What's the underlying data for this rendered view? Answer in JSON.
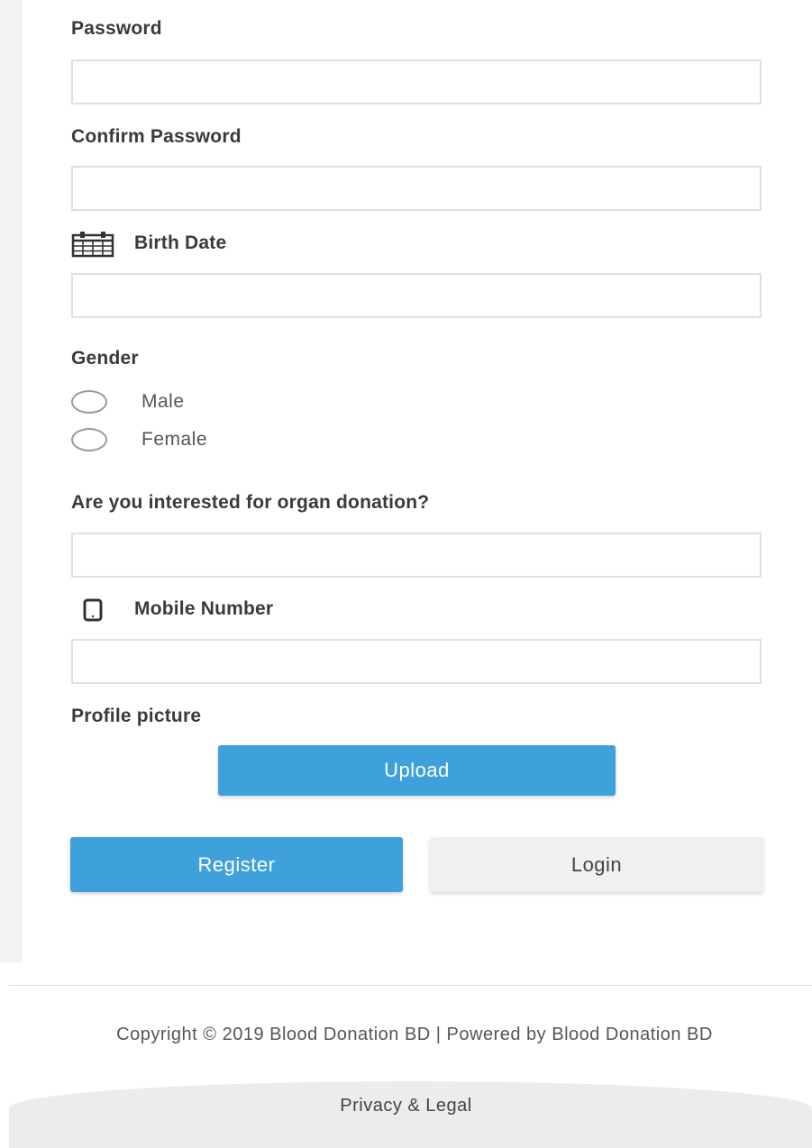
{
  "form": {
    "password_label": "Password",
    "confirm_password_label": "Confirm Password",
    "birth_date_label": "Birth Date",
    "gender_label": "Gender",
    "gender_options": [
      "Male",
      "Female"
    ],
    "organ_donation_label": "Are you interested for organ donation?",
    "mobile_label": "Mobile Number",
    "profile_picture_label": "Profile picture",
    "upload_label": "Upload",
    "register_label": "Register",
    "login_label": "Login"
  },
  "icons": {
    "birth_date": "calendar-icon",
    "mobile": "mobile-phone-icon"
  },
  "colors": {
    "primary": "#3ea1dc",
    "secondary_button": "#f0f0f0"
  },
  "footer": {
    "copyright": "Copyright © 2019 Blood Donation BD | Powered by Blood Donation BD",
    "privacy_link": "Privacy & Legal"
  }
}
